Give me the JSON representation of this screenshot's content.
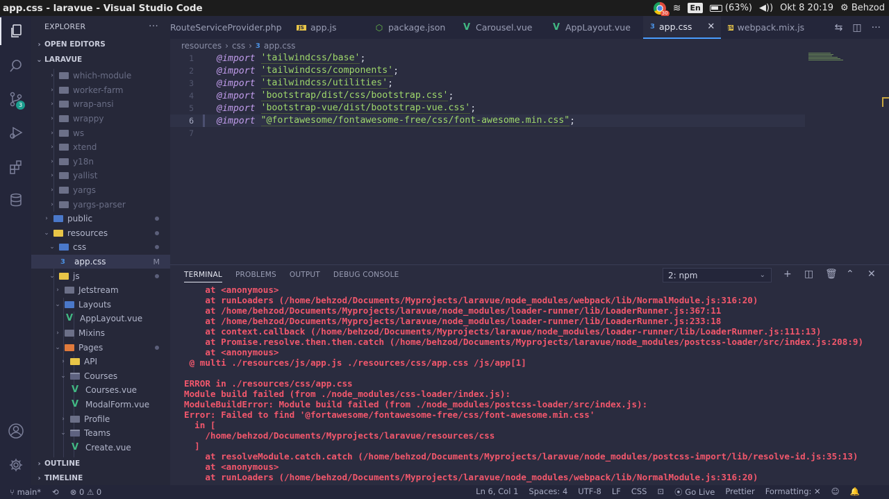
{
  "window": {
    "title": "app.css - laravue - Visual Studio Code",
    "tray": {
      "badge": "30",
      "lang": "En",
      "battery": "(63%)",
      "datetime": "Okt  8 20:19",
      "user": "Behzod"
    }
  },
  "activity": {
    "scm_badge": "3"
  },
  "sidebar": {
    "title": "EXPLORER",
    "open_editors": "OPEN EDITORS",
    "project": "LARAVUE",
    "outline": "OUTLINE",
    "timeline": "TIMELINE",
    "tree": [
      {
        "label": "which-module"
      },
      {
        "label": "worker-farm"
      },
      {
        "label": "wrap-ansi"
      },
      {
        "label": "wrappy"
      },
      {
        "label": "ws"
      },
      {
        "label": "xtend"
      },
      {
        "label": "y18n"
      },
      {
        "label": "yallist"
      },
      {
        "label": "yargs"
      },
      {
        "label": "yargs-parser"
      },
      {
        "label": "public"
      },
      {
        "label": "resources"
      },
      {
        "label": "css"
      },
      {
        "label": "app.css",
        "status": "M"
      },
      {
        "label": "js"
      },
      {
        "label": "Jetstream"
      },
      {
        "label": "Layouts"
      },
      {
        "label": "AppLayout.vue"
      },
      {
        "label": "Mixins"
      },
      {
        "label": "Pages"
      },
      {
        "label": "API"
      },
      {
        "label": "Courses"
      },
      {
        "label": "Courses.vue"
      },
      {
        "label": "ModalForm.vue"
      },
      {
        "label": "Profile"
      },
      {
        "label": "Teams"
      },
      {
        "label": "Create.vue"
      }
    ]
  },
  "tabs": [
    {
      "label": "RouteServiceProvider.php"
    },
    {
      "label": "app.js",
      "icon": "JS"
    },
    {
      "label": "package.json"
    },
    {
      "label": "Carousel.vue",
      "icon": "V"
    },
    {
      "label": "AppLayout.vue",
      "icon": "V"
    },
    {
      "label": "app.css",
      "icon": "3"
    },
    {
      "label": "webpack.mix.js",
      "icon": "JS"
    }
  ],
  "breadcrumb": [
    "resources",
    "css",
    "app.css"
  ],
  "code": [
    {
      "n": "1",
      "kw": "@import",
      "str": "'tailwindcss/base'",
      "end": ";"
    },
    {
      "n": "2",
      "kw": "@import",
      "str": "'tailwindcss/components'",
      "end": ";"
    },
    {
      "n": "3",
      "kw": "@import",
      "str": "'tailwindcss/utilities'",
      "end": ";"
    },
    {
      "n": "4",
      "kw": "@import",
      "str": "'bootstrap/dist/css/bootstrap.css'",
      "end": ";"
    },
    {
      "n": "5",
      "kw": "@import",
      "str": "'bootstrap-vue/dist/bootstrap-vue.css'",
      "end": ";"
    },
    {
      "n": "6",
      "kw": "@import",
      "str": "\"@fortawesome/fontawesome-free/css/font-awesome.min.css\"",
      "end": ";"
    },
    {
      "n": "7",
      "kw": "",
      "str": "",
      "end": ""
    }
  ],
  "panel": {
    "tabs": [
      "TERMINAL",
      "PROBLEMS",
      "OUTPUT",
      "DEBUG CONSOLE"
    ],
    "terminal_select": "2: npm",
    "lines": [
      "    at <anonymous>",
      "    at runLoaders (/home/behzod/Documents/Myprojects/laravue/node_modules/webpack/lib/NormalModule.js:316:20)",
      "    at /home/behzod/Documents/Myprojects/laravue/node_modules/loader-runner/lib/LoaderRunner.js:367:11",
      "    at /home/behzod/Documents/Myprojects/laravue/node_modules/loader-runner/lib/LoaderRunner.js:233:18",
      "    at context.callback (/home/behzod/Documents/Myprojects/laravue/node_modules/loader-runner/lib/LoaderRunner.js:111:13)",
      "    at Promise.resolve.then.then.catch (/home/behzod/Documents/Myprojects/laravue/node_modules/postcss-loader/src/index.js:208:9)",
      "    at <anonymous>",
      " @ multi ./resources/js/app.js ./resources/css/app.css /js/app[1]",
      "",
      "ERROR in ./resources/css/app.css",
      "Module build failed (from ./node_modules/css-loader/index.js):",
      "ModuleBuildError: Module build failed (from ./node_modules/postcss-loader/src/index.js):",
      "Error: Failed to find '@fortawesome/fontawesome-free/css/font-awesome.min.css'",
      "  in [",
      "    /home/behzod/Documents/Myprojects/laravue/resources/css",
      "  ]",
      "    at resolveModule.catch.catch (/home/behzod/Documents/Myprojects/laravue/node_modules/postcss-import/lib/resolve-id.js:35:13)",
      "    at <anonymous>",
      "    at runLoaders (/home/behzod/Documents/Myprojects/laravue/node_modules/webpack/lib/NormalModule.js:316:20)"
    ]
  },
  "status": {
    "branch": "main*",
    "problems": "⊗ 0 ⚠ 0",
    "position": "Ln 6, Col 1",
    "spaces": "Spaces: 4",
    "encoding": "UTF-8",
    "eol": "LF",
    "language": "CSS",
    "golive": "Go Live",
    "prettier": "Prettier",
    "formatting": "Formatting: ✕"
  }
}
